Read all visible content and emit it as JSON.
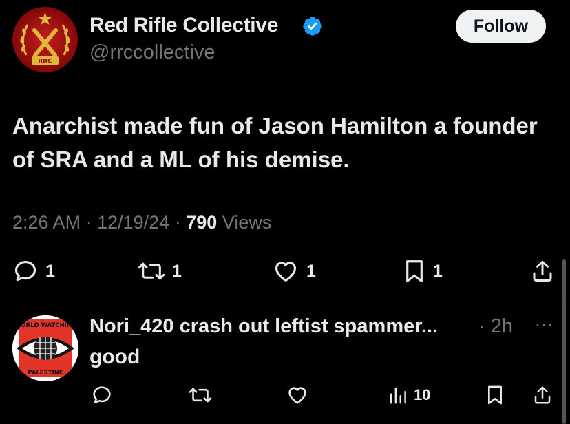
{
  "tweet": {
    "author": {
      "display_name": "Red Rifle Collective",
      "handle": "@rrccollective",
      "verified": true,
      "avatar_text": "RRC"
    },
    "follow_label": "Follow",
    "text": "Anarchist made fun of Jason Hamilton a founder of SRA and a ML of his demise.",
    "time": "2:26 AM",
    "sep1": "·",
    "date": "12/19/24",
    "sep2": "·",
    "views_count": "790",
    "views_label": "Views",
    "actions": {
      "replies": "1",
      "reposts": "1",
      "likes": "1",
      "bookmarks": "1"
    }
  },
  "reply": {
    "display_name": "Nori_420 crash out leftist spammer...",
    "time": "· 2h",
    "more": "···",
    "text": "good",
    "avatar_text_top": "WORLD WATCHING",
    "avatar_text_bottom": "PALESTINE",
    "actions": {
      "views": "10"
    }
  },
  "colors": {
    "background": "#000000",
    "text": "#e7e9ea",
    "muted": "#71767b",
    "verified": "#1d9bf0",
    "follow_bg": "#eff3f4"
  }
}
